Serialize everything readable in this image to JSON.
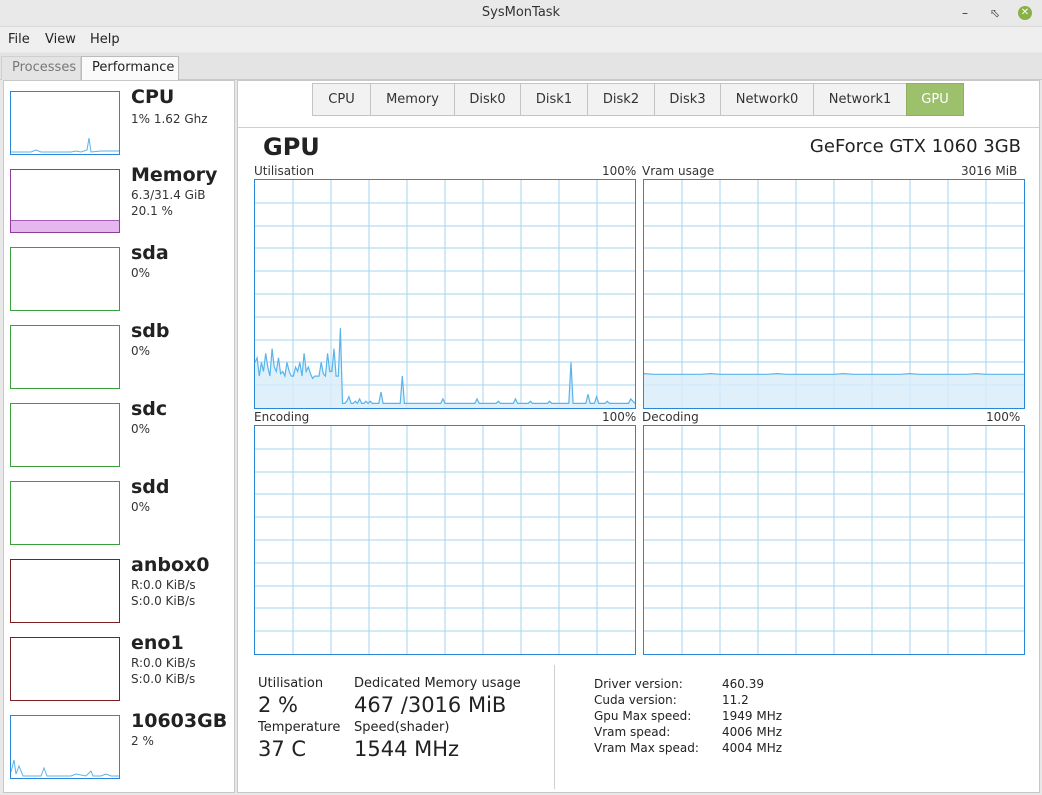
{
  "window": {
    "title": "SysMonTask"
  },
  "menu": {
    "file": "File",
    "view": "View",
    "help": "Help"
  },
  "tabs": {
    "processes": "Processes",
    "performance": "Performance"
  },
  "sidebar": {
    "cpu": {
      "name": "CPU",
      "line1": "1% 1.62 Ghz"
    },
    "memory": {
      "name": "Memory",
      "line1": "6.3/31.4 GiB",
      "line2": "20.1 %",
      "usage_fraction": 0.201
    },
    "sda": {
      "name": "sda",
      "line1": "0%"
    },
    "sdb": {
      "name": "sdb",
      "line1": "0%"
    },
    "sdc": {
      "name": "sdc",
      "line1": "0%"
    },
    "sdd": {
      "name": "sdd",
      "line1": "0%"
    },
    "anbox0": {
      "name": "anbox0",
      "line1": "R:0.0 KiB/s",
      "line2": "S:0.0 KiB/s"
    },
    "eno1": {
      "name": "eno1",
      "line1": "R:0.0 KiB/s",
      "line2": "S:0.0 KiB/s"
    },
    "gpu": {
      "name": "10603GB",
      "line1": "2 %"
    }
  },
  "device_tabs": [
    "CPU",
    "Memory",
    "Disk0",
    "Disk1",
    "Disk2",
    "Disk3",
    "Network0",
    "Network1",
    "GPU"
  ],
  "gpu": {
    "title": "GPU",
    "model": "GeForce GTX 1060 3GB",
    "graphs": {
      "utilisation": {
        "label": "Utilisation",
        "max": "100%"
      },
      "vram": {
        "label": "Vram usage",
        "max": "3016 MiB"
      },
      "encoding": {
        "label": "Encoding",
        "max": "100%"
      },
      "decoding": {
        "label": "Decoding",
        "max": "100%"
      }
    },
    "stats": {
      "utilisation_label": "Utilisation",
      "utilisation_value": "2 %",
      "temperature_label": "Temperature",
      "temperature_value": "37 C",
      "dedicated_label": "Dedicated Memory usage",
      "dedicated_value": "467 /3016 MiB",
      "speed_label": "Speed(shader)",
      "speed_value": "1544 MHz"
    },
    "info": [
      {
        "label": "Driver version:",
        "value": "460.39"
      },
      {
        "label": "Cuda version:",
        "value": "11.2"
      },
      {
        "label": "Gpu Max speed:",
        "value": "1949 MHz"
      },
      {
        "label": "Vram spead:",
        "value": "4006 MHz"
      },
      {
        "label": "Vram Max spead:",
        "value": "4004 MHz"
      }
    ]
  },
  "colors": {
    "cpu": "#2a86d8",
    "memory": "#8e3b9c",
    "disk": "#3aa03a",
    "network": "#7a2020",
    "gpu_tab_active": "#9dc06c",
    "graph_line": "#5ab4ea",
    "graph_fill": "#d8ecfa",
    "grid": "#a6d4f2"
  }
}
